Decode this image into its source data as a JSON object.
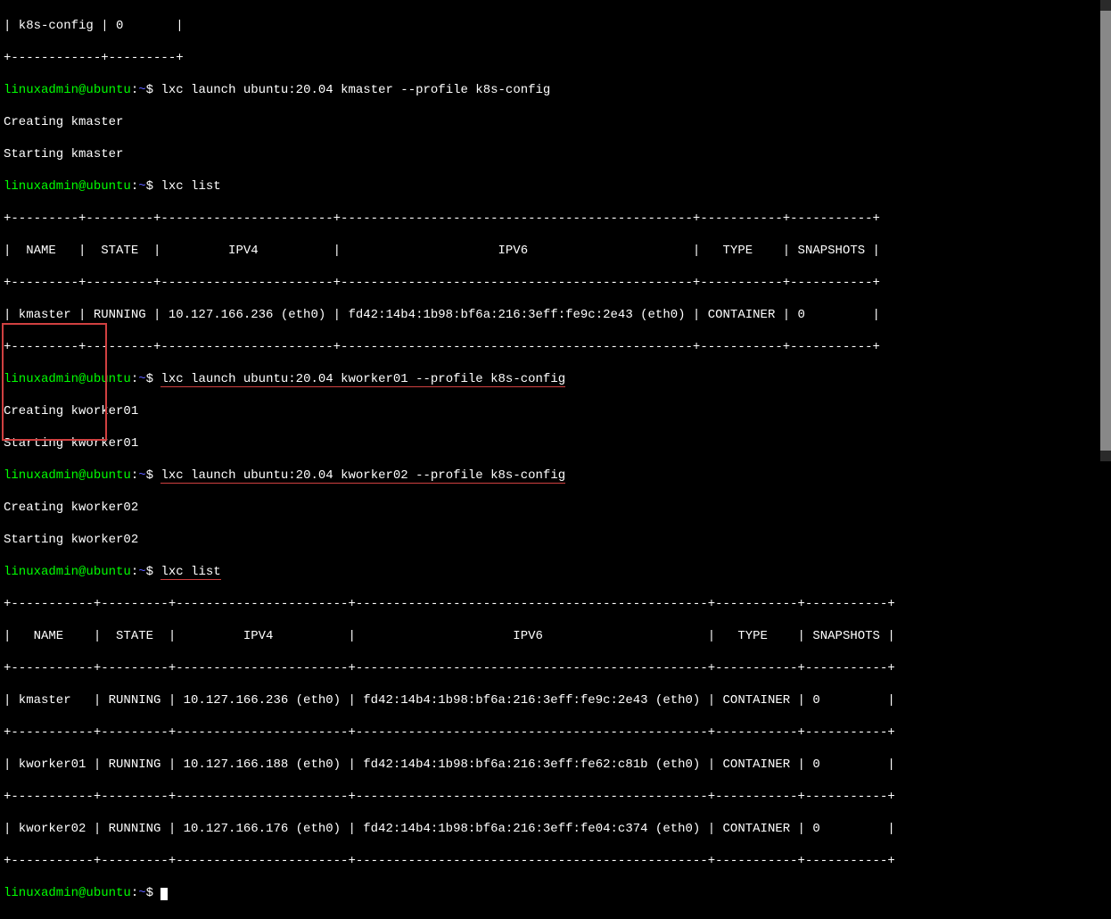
{
  "lines": {
    "l0": "| k8s-config | 0       |",
    "l1": "+------------+---------+",
    "prompt_user": "linuxadmin@ubuntu",
    "colon": ":",
    "tilde": "~",
    "dollar": "$ ",
    "cmd1": "lxc launch ubuntu:20.04 kmaster --profile k8s-config",
    "l3": "Creating kmaster",
    "l4": "Starting kmaster",
    "cmd2": "lxc list",
    "sep1": "+---------+---------+-----------------------+-----------------------------------------------+-----------+-----------+",
    "hdr1": "|  NAME   |  STATE  |         IPV4          |                     IPV6                      |   TYPE    | SNAPSHOTS |",
    "row1": "| kmaster | RUNNING | 10.127.166.236 (eth0) | fd42:14b4:1b98:bf6a:216:3eff:fe9c:2e43 (eth0) | CONTAINER | 0         |",
    "cmd3": "lxc launch ubuntu:20.04 kworker01 --profile k8s-config",
    "l10": "Creating kworker01",
    "l11": "Starting kworker01",
    "cmd4": "lxc launch ubuntu:20.04 kworker02 --profile k8s-config",
    "l13": "Creating kworker02",
    "l14": "Starting kworker02",
    "cmd5": "lxc list",
    "sep2": "+-----------+---------+-----------------------+-----------------------------------------------+-----------+-----------+",
    "hdr2": "|   NAME    |  STATE  |         IPV4          |                     IPV6                      |   TYPE    | SNAPSHOTS |",
    "row2a": "| kmaster   | RUNNING | 10.127.166.236 (eth0) | fd42:14b4:1b98:bf6a:216:3eff:fe9c:2e43 (eth0) | CONTAINER | 0         |",
    "row2b": "| kworker01 | RUNNING | 10.127.166.188 (eth0) | fd42:14b4:1b98:bf6a:216:3eff:fe62:c81b (eth0) | CONTAINER | 0         |",
    "row2c": "| kworker02 | RUNNING | 10.127.166.176 (eth0) | fd42:14b4:1b98:bf6a:216:3eff:fe04:c374 (eth0) | CONTAINER | 0         |"
  }
}
